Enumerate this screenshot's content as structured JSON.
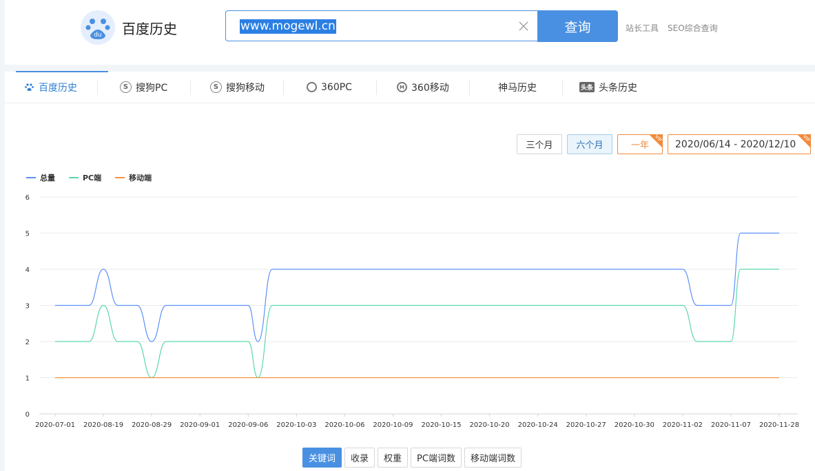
{
  "header": {
    "logo_text": "百度历史",
    "search_value": "www.mogewl.cn",
    "search_button": "查询",
    "links": [
      "站长工具",
      "SEO综合查询"
    ]
  },
  "tabs": [
    {
      "label": "百度历史",
      "icon": "paw-icon",
      "active": true
    },
    {
      "label": "搜狗PC",
      "icon": "sogou-icon"
    },
    {
      "label": "搜狗移动",
      "icon": "sogou-icon"
    },
    {
      "label": "360PC",
      "icon": "360-icon"
    },
    {
      "label": "360移动",
      "icon": "360-mobile-icon"
    },
    {
      "label": "神马历史",
      "icon": ""
    },
    {
      "label": "头条历史",
      "icon": "toutiao-icon"
    }
  ],
  "range": {
    "options": [
      "三个月",
      "六个月",
      "一年"
    ],
    "active": "六个月",
    "vip_badge": "VIP",
    "date_range": "2020/06/14 - 2020/12/10"
  },
  "colors": {
    "accent": "#4a90e2",
    "total": "#5b8ff9",
    "pc": "#5ad8a6",
    "mobile": "#f6903d"
  },
  "chart_data": {
    "type": "line",
    "x": [
      "2020-07-01",
      "2020-08-19",
      "2020-08-29",
      "2020-09-01",
      "2020-09-06",
      "2020-10-03",
      "2020-10-06",
      "2020-10-09",
      "2020-10-15",
      "2020-10-20",
      "2020-10-24",
      "2020-10-27",
      "2020-10-30",
      "2020-11-02",
      "2020-11-07",
      "2020-11-28"
    ],
    "y_ticks": [
      0,
      1,
      2,
      3,
      4,
      5,
      6
    ],
    "ylim": [
      0,
      6
    ],
    "grid": true,
    "legend_position": "top-left",
    "series": [
      {
        "name": "总量",
        "color": "#5b8ff9",
        "points": [
          [
            0,
            3
          ],
          [
            0.7,
            3
          ],
          [
            1,
            4
          ],
          [
            1.3,
            3
          ],
          [
            1.7,
            3
          ],
          [
            2,
            2
          ],
          [
            2.3,
            3
          ],
          [
            4,
            3
          ],
          [
            4.2,
            2
          ],
          [
            4.5,
            4
          ],
          [
            13,
            4
          ],
          [
            13.3,
            3
          ],
          [
            14,
            3
          ],
          [
            14.2,
            5
          ],
          [
            15,
            5
          ]
        ]
      },
      {
        "name": "PC端",
        "color": "#5ad8a6",
        "points": [
          [
            0,
            2
          ],
          [
            0.7,
            2
          ],
          [
            1,
            3
          ],
          [
            1.3,
            2
          ],
          [
            1.7,
            2
          ],
          [
            2,
            1
          ],
          [
            2.3,
            2
          ],
          [
            4,
            2
          ],
          [
            4.2,
            1
          ],
          [
            4.5,
            3
          ],
          [
            13,
            3
          ],
          [
            13.3,
            2
          ],
          [
            14,
            2
          ],
          [
            14.2,
            4
          ],
          [
            15,
            4
          ]
        ]
      },
      {
        "name": "移动端",
        "color": "#f6903d",
        "points": [
          [
            0,
            1
          ],
          [
            15,
            1
          ]
        ]
      }
    ]
  },
  "metrics": {
    "buttons": [
      "关键词",
      "收录",
      "权重",
      "PC端词数",
      "移动端词数"
    ],
    "active": "关键词"
  }
}
